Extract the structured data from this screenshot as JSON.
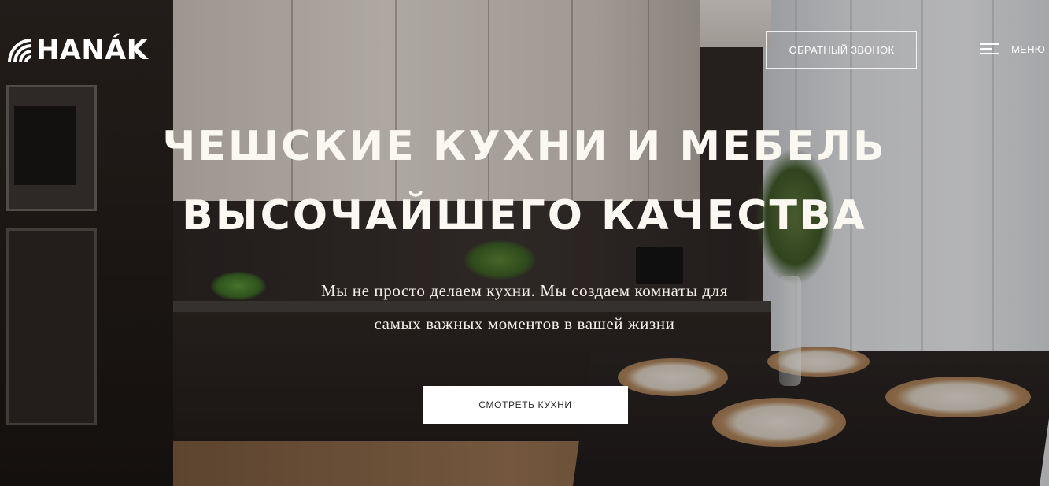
{
  "brand": {
    "name": "HANÁK",
    "logo_icon": "striped-arc-logo-icon"
  },
  "header": {
    "callback_label": "ОБРАТНЫЙ ЗВОНОК",
    "menu_label": "МЕНЮ",
    "menu_icon": "hamburger-menu-icon"
  },
  "hero": {
    "headline_line1": "ЧЕШСКИЕ КУХНИ И МЕБЕЛЬ",
    "headline_line2": "ВЫСОЧАЙШЕГО КАЧЕСТВА",
    "subtitle_line1": "Мы не просто делаем кухни. Мы создаем комнаты для",
    "subtitle_line2": "самых важных моментов в вашей жизни",
    "cta_label": "СМОТРЕТЬ КУХНИ"
  },
  "colors": {
    "text": "#ffffff",
    "button_bg": "#ffffff",
    "button_text": "#2b2b2b"
  }
}
